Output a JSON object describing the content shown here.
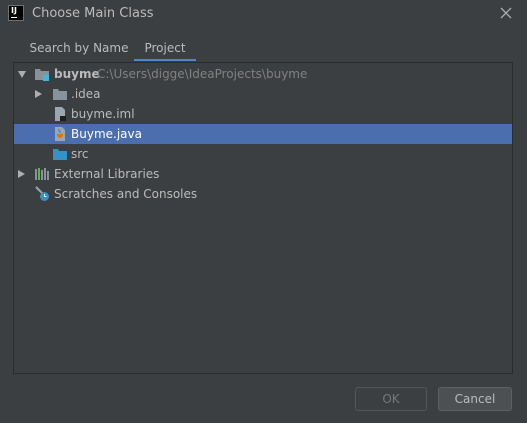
{
  "window": {
    "title": "Choose Main Class",
    "logo_text": "IJ"
  },
  "tabs": [
    {
      "label": "Search by Name",
      "active": false
    },
    {
      "label": "Project",
      "active": true
    }
  ],
  "tree": {
    "root": {
      "name": "buyme",
      "path": "C:\\Users\\digge\\IdeaProjects\\buyme"
    },
    "items": [
      {
        "label": ".idea",
        "icon": "folder-icon"
      },
      {
        "label": "buyme.iml",
        "icon": "iml-file-icon"
      },
      {
        "label": "Buyme.java",
        "icon": "java-class-icon",
        "selected": true
      },
      {
        "label": "src",
        "icon": "source-folder-icon"
      },
      {
        "label": "External Libraries",
        "icon": "libraries-icon"
      },
      {
        "label": "Scratches and Consoles",
        "icon": "scratches-icon"
      }
    ]
  },
  "buttons": {
    "ok": "OK",
    "cancel": "Cancel"
  },
  "colors": {
    "background": "#3c3f41",
    "selection": "#4b6eaf",
    "accent": "#4a88c7"
  }
}
